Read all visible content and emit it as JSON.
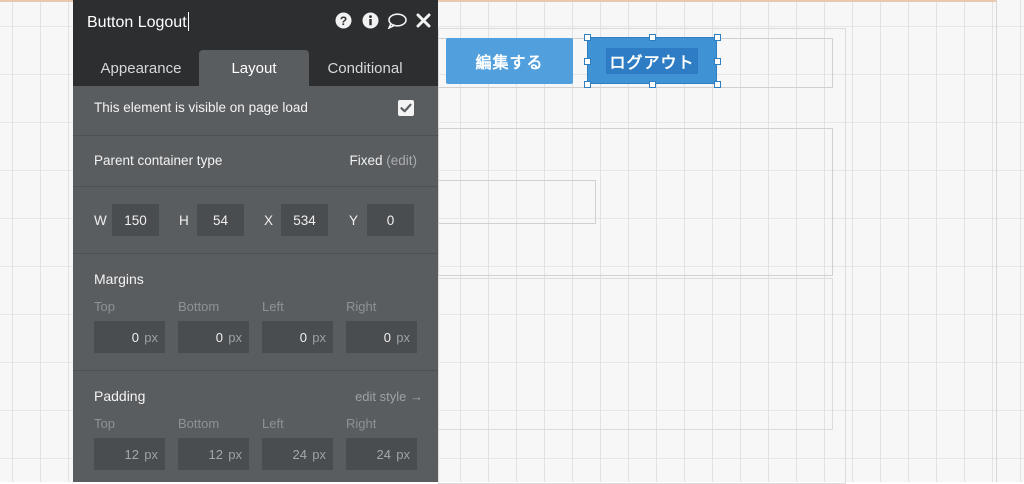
{
  "panel": {
    "title": "Button Logout",
    "tabs": [
      {
        "label": "Appearance",
        "active": false
      },
      {
        "label": "Layout",
        "active": true
      },
      {
        "label": "Conditional",
        "active": false
      }
    ],
    "visible_label": "This element is visible on page load",
    "visible_checked": true,
    "parent_label": "Parent container type",
    "parent_value": "Fixed",
    "parent_edit": "(edit)",
    "dims": {
      "w_label": "W",
      "w": "150",
      "h_label": "H",
      "h": "54",
      "x_label": "X",
      "x": "534",
      "y_label": "Y",
      "y": "0"
    },
    "margins": {
      "title": "Margins",
      "labels": [
        "Top",
        "Bottom",
        "Left",
        "Right"
      ],
      "values": [
        "0",
        "0",
        "0",
        "0"
      ],
      "unit": "px"
    },
    "padding": {
      "title": "Padding",
      "edit_style": "edit style →",
      "labels": [
        "Top",
        "Bottom",
        "Left",
        "Right"
      ],
      "values": [
        "12",
        "12",
        "24",
        "24"
      ],
      "unit": "px"
    },
    "header_icons": [
      "help-icon",
      "info-icon",
      "comment-icon",
      "close-icon"
    ]
  },
  "canvas": {
    "edit_button": "編集する",
    "logout_button": "ログアウト"
  },
  "colors": {
    "panel_bg": "#5a5d60",
    "header_bg": "#2c2e30",
    "button_blue": "#4a9bd9"
  }
}
